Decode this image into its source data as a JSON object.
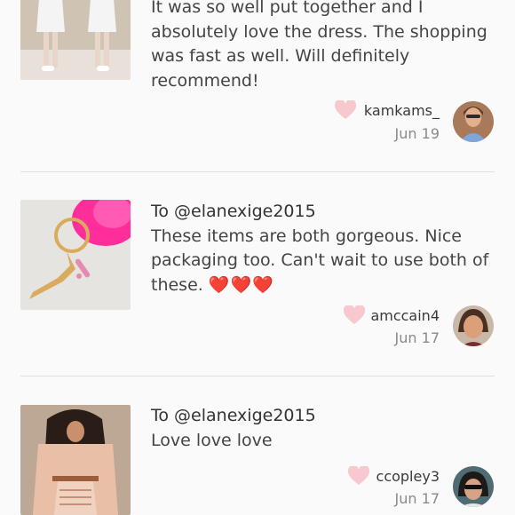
{
  "reviews": [
    {
      "to": "",
      "text": "It was so well put together and I absolutely love the dress. The shopping was fast as well. Will definitely recommend!",
      "hearts": "",
      "username": "kamkams_",
      "date": "Jun 19",
      "like_icon": "heart-outline-icon"
    },
    {
      "to": "To @elanexige2015",
      "text": "These items are both gorgeous. Nice packaging too. Can't wait to use both of these.",
      "hearts": "❤️❤️❤️",
      "username": "amccain4",
      "date": "Jun 17",
      "like_icon": "heart-outline-icon"
    },
    {
      "to": "To @elanexige2015",
      "text": "Love love love",
      "hearts": "",
      "username": "ccopley3",
      "date": "Jun 17",
      "like_icon": "heart-outline-icon"
    }
  ],
  "colors": {
    "like_heart": "#f7c9cf",
    "emoji_heart": "#e0262a",
    "divider": "#dedede"
  }
}
